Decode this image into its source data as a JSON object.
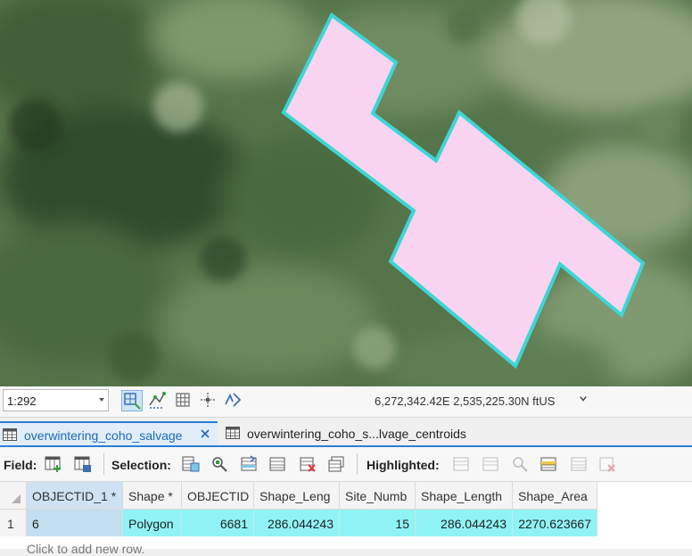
{
  "map": {
    "scale": "1:292",
    "coordinates": "6,272,342.42E 2,535,225.30N ftUS",
    "polygon_fill": "#f9d4f1",
    "polygon_outline": "#3cd6d6"
  },
  "statusbar_icons": [
    "snap-grid-icon",
    "snapping-icon",
    "grid-icon",
    "crosshair-icon",
    "correction-icon"
  ],
  "tabs": [
    {
      "label": "overwintering_coho_salvage",
      "active": true
    },
    {
      "label": "overwintering_coho_s...lvage_centroids",
      "active": false
    }
  ],
  "toolbar": {
    "field_label": "Field:",
    "selection_label": "Selection:",
    "highlighted_label": "Highlighted:"
  },
  "table": {
    "columns": [
      "OBJECTID_1 *",
      "Shape *",
      "OBJECTID",
      "Shape_Leng",
      "Site_Numb",
      "Shape_Length",
      "Shape_Area"
    ],
    "rows": [
      {
        "row_number": "1",
        "cells": [
          "6",
          "Polygon",
          "6681",
          "286.044243",
          "15",
          "286.044243",
          "2270.623667"
        ]
      }
    ],
    "add_row_hint": "Click to add new row."
  }
}
